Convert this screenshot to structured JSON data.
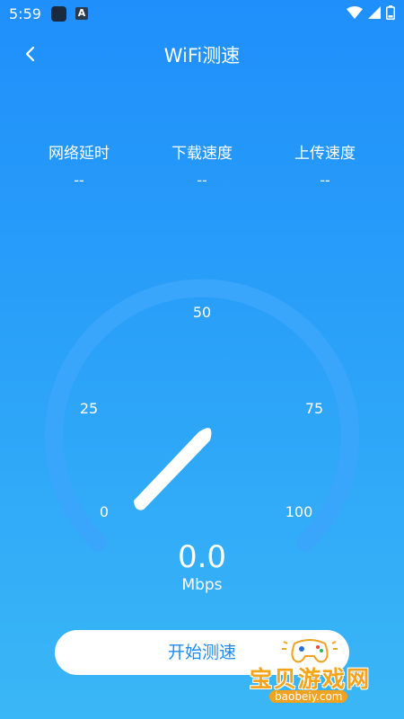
{
  "status_bar": {
    "time": "5:59",
    "a_icon_label": "A"
  },
  "header": {
    "title": "WiFi测速",
    "back_icon": "chevron-left-icon"
  },
  "metrics": [
    {
      "label": "网络延时",
      "value": "--"
    },
    {
      "label": "下载速度",
      "value": "--"
    },
    {
      "label": "上传速度",
      "value": "--"
    }
  ],
  "gauge": {
    "ticks": [
      "0",
      "25",
      "50",
      "75",
      "100"
    ],
    "min": 0,
    "max": 100,
    "current": 0.0
  },
  "speed": {
    "value": "0.0",
    "unit": "Mbps"
  },
  "start_button": {
    "label": "开始测速"
  },
  "watermark": {
    "text": "宝贝游戏网",
    "url": "baobeiy.com"
  },
  "colors": {
    "background_top": "#1f8ffb",
    "background_bottom": "#3ab7f6",
    "button_text": "#1d8bf5",
    "gauge_track": "#3aa6fb"
  }
}
